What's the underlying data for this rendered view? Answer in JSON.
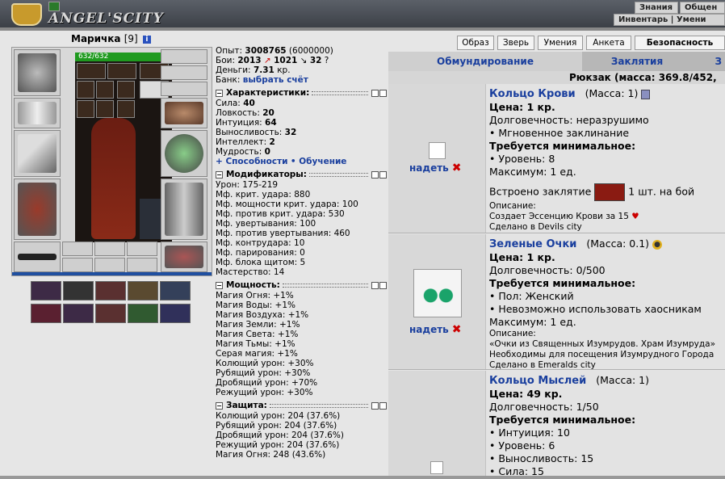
{
  "header": {
    "brand": "ANGEL'SCITY",
    "links": [
      "Знания",
      "Общен",
      "Инвентарь | Умени"
    ]
  },
  "character": {
    "name": "Маричка",
    "level": "[9]",
    "hp": "632/632"
  },
  "stats": {
    "exp_label": "Опыт:",
    "exp_value": "3008765",
    "exp_next": "(6000000)",
    "fights_label": "Бои:",
    "wins": "2013",
    "losses": "1021",
    "draws": "32",
    "money_label": "Деньги:",
    "money_value": "7.31",
    "money_unit": "кр.",
    "bank_label": "Банк:",
    "bank_link": "выбрать счёт"
  },
  "sections": [
    {
      "title": "Характеристики:",
      "rows": [
        "Сила: 40",
        "Ловкость: 20",
        "Интуиция: 64",
        "Выносливость: 32",
        "Интеллект: 2",
        "Мудрость: 0"
      ],
      "links": [
        "+ Способности",
        "• Обучение"
      ]
    },
    {
      "title": "Модификаторы:",
      "rows": [
        "Урон: 175-219",
        "Мф. крит. удара: 880",
        "Мф. мощности крит. удара: 100",
        "Мф. против крит. удара: 530",
        "Мф. увертывания: 100",
        "Мф. против увертывания: 460",
        "Мф. контрудара: 10",
        "Мф. парирования: 0",
        "Мф. блока щитом: 5",
        "Мастерство: 14"
      ]
    },
    {
      "title": "Мощность:",
      "rows": [
        "Магия Огня: +1%",
        "Магия Воды: +1%",
        "Магия Воздуха: +1%",
        "Магия Земли: +1%",
        "Магия Света: +1%",
        "Магия Тьмы: +1%",
        "Серая магия: +1%",
        "Колющий урон: +30%",
        "Рубящий урон: +30%",
        "Дробящий урон: +70%",
        "Режущий урон: +30%"
      ]
    },
    {
      "title": "Защита:",
      "rows": [
        "Колющий урон: 204 (37.6%)",
        "Рубящий урон: 204 (37.6%)",
        "Дробящий урон: 204 (37.6%)",
        "Режущий урон: 204 (37.6%)",
        "Магия Огня: 248 (43.6%)"
      ]
    }
  ],
  "tab_buttons": [
    "Образ",
    "Зверь",
    "Умения",
    "Анкета",
    "Безопасность"
  ],
  "inventory_tabs": [
    "Обмундирование",
    "Заклятия",
    "З"
  ],
  "backpack_label": "Рюкзак (масса: 369.8/452,",
  "items": [
    {
      "title": "Кольцо Крови",
      "mass": "(Масса: 1)",
      "wear": "надеть",
      "lines": [
        {
          "b": "Цена: 1 кр."
        },
        {
          "t": "Долговечность: неразрушимо"
        },
        {
          "t": "• Мгновенное заклинание"
        },
        {
          "b": "Требуется минимальное:"
        },
        {
          "t": "• Уровень: 8"
        },
        {
          "t": "Максимум: 1 ед."
        }
      ],
      "embed_pre": "Встроено заклятие",
      "embed_post": "1 шт. на бой",
      "desc": [
        "Описание:",
        "Создает Эссенцию Крови за 15",
        "Сделано в Devils city"
      ]
    },
    {
      "title": "Зеленые Очки",
      "mass": "(Масса: 0.1)",
      "wear": "надеть",
      "lines": [
        {
          "b": "Цена: 1 кр."
        },
        {
          "t": "Долговечность: 0/500"
        },
        {
          "b": "Требуется минимальное:"
        },
        {
          "t": "• Пол: Женский"
        },
        {
          "t": "• Невозможно использовать хаосникам"
        },
        {
          "t": "Максимум: 1 ед."
        }
      ],
      "desc": [
        "Описание:",
        "«Очки из Священных Изумрудов. Храм Изумруда»",
        "Необходимы для посещения Изумрудного Города",
        "Сделано в Emeralds city"
      ]
    },
    {
      "title": "Кольцо Мыслей",
      "mass": "(Масса: 1)",
      "lines": [
        {
          "b": "Цена: 49 кр."
        },
        {
          "t": "Долговечность: 1/50"
        },
        {
          "b": "Требуется минимальное:"
        },
        {
          "t": "• Интуиция: 10"
        },
        {
          "t": "• Уровень: 6"
        },
        {
          "t": "• Выносливость: 15"
        },
        {
          "t": "• Сила: 15"
        }
      ]
    }
  ]
}
